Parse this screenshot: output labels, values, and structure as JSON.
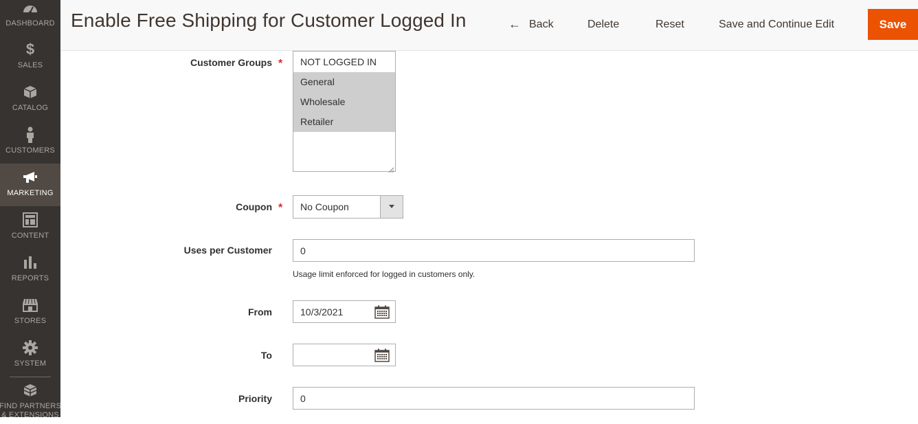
{
  "sidebar": {
    "items": [
      {
        "label": "DASHBOARD",
        "icon": "dashboard-icon"
      },
      {
        "label": "SALES",
        "icon": "dollar-icon"
      },
      {
        "label": "CATALOG",
        "icon": "box-icon"
      },
      {
        "label": "CUSTOMERS",
        "icon": "person-icon"
      },
      {
        "label": "MARKETING",
        "icon": "megaphone-icon",
        "active": true
      },
      {
        "label": "CONTENT",
        "icon": "layout-icon"
      },
      {
        "label": "REPORTS",
        "icon": "bar-chart-icon"
      },
      {
        "label": "STORES",
        "icon": "storefront-icon"
      },
      {
        "label": "SYSTEM",
        "icon": "gear-icon"
      }
    ],
    "partners_line1": "FIND PARTNERS",
    "partners_line2": "& EXTENSIONS"
  },
  "header": {
    "title": "Enable Free Shipping for Customer Logged In",
    "back_label": "Back",
    "delete_label": "Delete",
    "reset_label": "Reset",
    "save_continue_label": "Save and Continue Edit",
    "save_label": "Save"
  },
  "form": {
    "customer_groups": {
      "label": "Customer Groups",
      "options": [
        "NOT LOGGED IN",
        "General",
        "Wholesale",
        "Retailer"
      ],
      "selected": [
        "General",
        "Wholesale",
        "Retailer"
      ]
    },
    "coupon": {
      "label": "Coupon",
      "value": "No Coupon"
    },
    "uses_per_customer": {
      "label": "Uses per Customer",
      "value": "0",
      "note": "Usage limit enforced for logged in customers only."
    },
    "from": {
      "label": "From",
      "value": "10/3/2021"
    },
    "to": {
      "label": "To",
      "value": ""
    },
    "priority": {
      "label": "Priority",
      "value": "0"
    }
  },
  "colors": {
    "sidebar_bg": "#373330",
    "sidebar_active": "#514943",
    "primary_button": "#eb5202",
    "required": "#e22626"
  }
}
